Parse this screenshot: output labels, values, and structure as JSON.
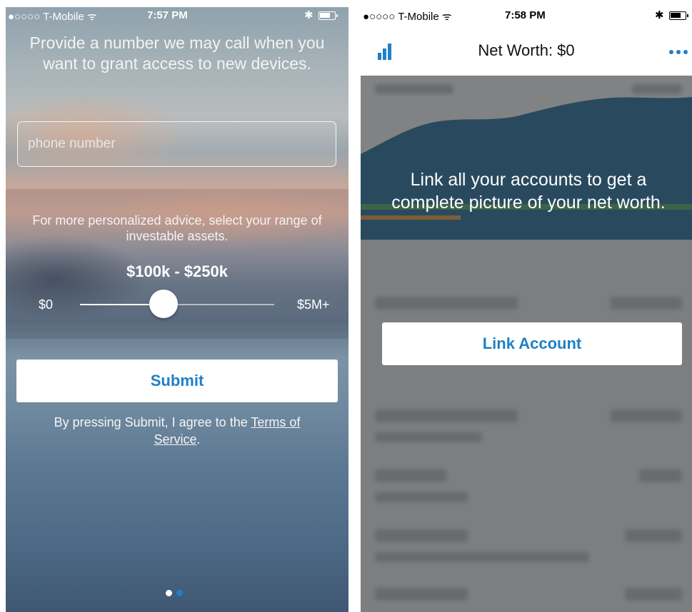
{
  "left": {
    "status": {
      "carrier": "●○○○○ T-Mobile ᯤ",
      "time": "7:57 PM",
      "bluetooth": "✱"
    },
    "prompt": "Provide a number we may call when you want to grant access to new devices.",
    "phone_field": {
      "placeholder": "phone number",
      "value": ""
    },
    "advice": "For more personalized advice, select your range of investable assets.",
    "range_value": "$100k - $250k",
    "slider": {
      "min_label": "$0",
      "max_label": "$5M+",
      "position_fraction": 0.43
    },
    "submit_label": "Submit",
    "terms_prefix": "By pressing Submit, I agree to the ",
    "terms_link": "Terms of Service",
    "terms_suffix": ".",
    "page_dots": {
      "count": 2,
      "active_index": 1,
      "active_color": "#1f80c6",
      "inactive_color": "#ffffff"
    }
  },
  "right": {
    "status": {
      "carrier": "●○○○○ T-Mobile ᯤ",
      "time": "7:58 PM",
      "bluetooth": "✱"
    },
    "nav_title": "Net Worth: $0",
    "nav_left_icon": "bar-chart-icon",
    "nav_right_icon": "more-icon",
    "link_message": "Link all your accounts to get a complete picture of your net worth.",
    "link_button_label": "Link Account"
  },
  "colors": {
    "accent": "#1f80c6",
    "chart_fill": "#0f5d8c"
  }
}
